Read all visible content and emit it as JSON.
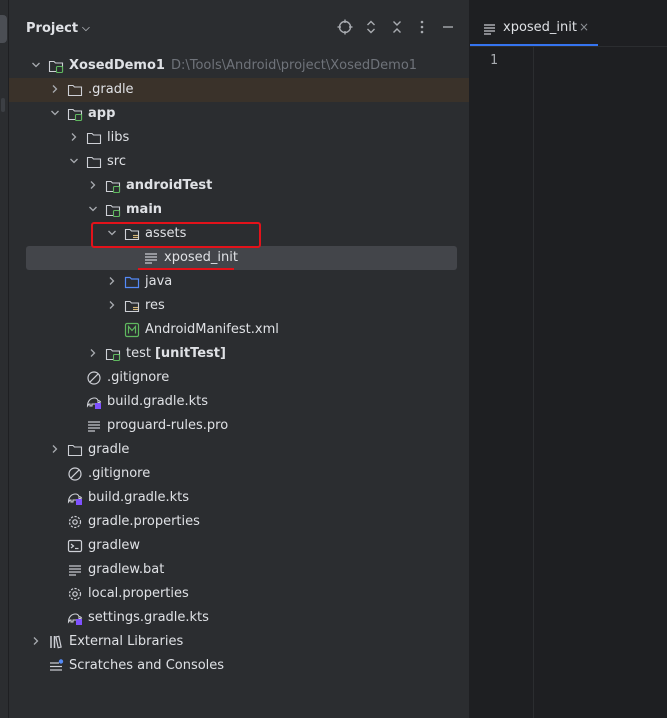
{
  "panel": {
    "title": "Project"
  },
  "tree": [
    {
      "label": "XosedDemo1",
      "hint": "D:\\Tools\\Android\\project\\XosedDemo1",
      "icon": "module-folder-icon",
      "arrow": "down",
      "depth": 0,
      "bold": true
    },
    {
      "label": ".gradle",
      "icon": "folder-icon",
      "arrow": "right",
      "depth": 1,
      "highlight": true
    },
    {
      "label": "app",
      "icon": "module-folder-icon",
      "arrow": "down",
      "depth": 1,
      "bold": true
    },
    {
      "label": "libs",
      "icon": "folder-icon",
      "arrow": "right",
      "depth": 2
    },
    {
      "label": "src",
      "icon": "folder-icon",
      "arrow": "down",
      "depth": 2
    },
    {
      "label": "androidTest",
      "icon": "source-folder-icon",
      "arrow": "right",
      "depth": 3,
      "bold": true
    },
    {
      "label": "main",
      "icon": "source-folder-icon",
      "arrow": "down",
      "depth": 3,
      "bold": true
    },
    {
      "label": "assets",
      "icon": "resource-folder-icon",
      "arrow": "down",
      "depth": 4
    },
    {
      "label": "xposed_init",
      "icon": "text-file-icon",
      "arrow": "",
      "depth": 5,
      "selected": true
    },
    {
      "label": "java",
      "icon": "source-root-icon",
      "arrow": "right",
      "depth": 4
    },
    {
      "label": "res",
      "icon": "resource-folder-icon",
      "arrow": "right",
      "depth": 4
    },
    {
      "label": "AndroidManifest.xml",
      "icon": "manifest-icon",
      "arrow": "",
      "depth": 4
    },
    {
      "label": "test",
      "hint_bold": "[unitTest]",
      "icon": "test-folder-icon",
      "arrow": "right",
      "depth": 3
    },
    {
      "label": ".gitignore",
      "icon": "ignore-file-icon",
      "arrow": "",
      "depth": 2
    },
    {
      "label": "build.gradle.kts",
      "icon": "gradle-kts-icon",
      "arrow": "",
      "depth": 2
    },
    {
      "label": "proguard-rules.pro",
      "icon": "text-file-icon",
      "arrow": "",
      "depth": 2
    },
    {
      "label": "gradle",
      "icon": "folder-icon",
      "arrow": "right",
      "depth": 1
    },
    {
      "label": ".gitignore",
      "icon": "ignore-file-icon",
      "arrow": "",
      "depth": 1
    },
    {
      "label": "build.gradle.kts",
      "icon": "gradle-kts-icon",
      "arrow": "",
      "depth": 1
    },
    {
      "label": "gradle.properties",
      "icon": "settings-gear-icon",
      "arrow": "",
      "depth": 1
    },
    {
      "label": "gradlew",
      "icon": "terminal-file-icon",
      "arrow": "",
      "depth": 1
    },
    {
      "label": "gradlew.bat",
      "icon": "text-file-icon",
      "arrow": "",
      "depth": 1
    },
    {
      "label": "local.properties",
      "icon": "settings-gear-icon",
      "arrow": "",
      "depth": 1
    },
    {
      "label": "settings.gradle.kts",
      "icon": "gradle-kts-icon",
      "arrow": "",
      "depth": 1
    },
    {
      "label": "External Libraries",
      "icon": "library-icon",
      "arrow": "right",
      "depth": 0
    },
    {
      "label": "Scratches and Consoles",
      "icon": "scratches-icon",
      "arrow": "",
      "depth": 0
    }
  ],
  "editor": {
    "tab_label": "xposed_init",
    "tab_close": "×",
    "line_numbers": [
      "1"
    ]
  }
}
